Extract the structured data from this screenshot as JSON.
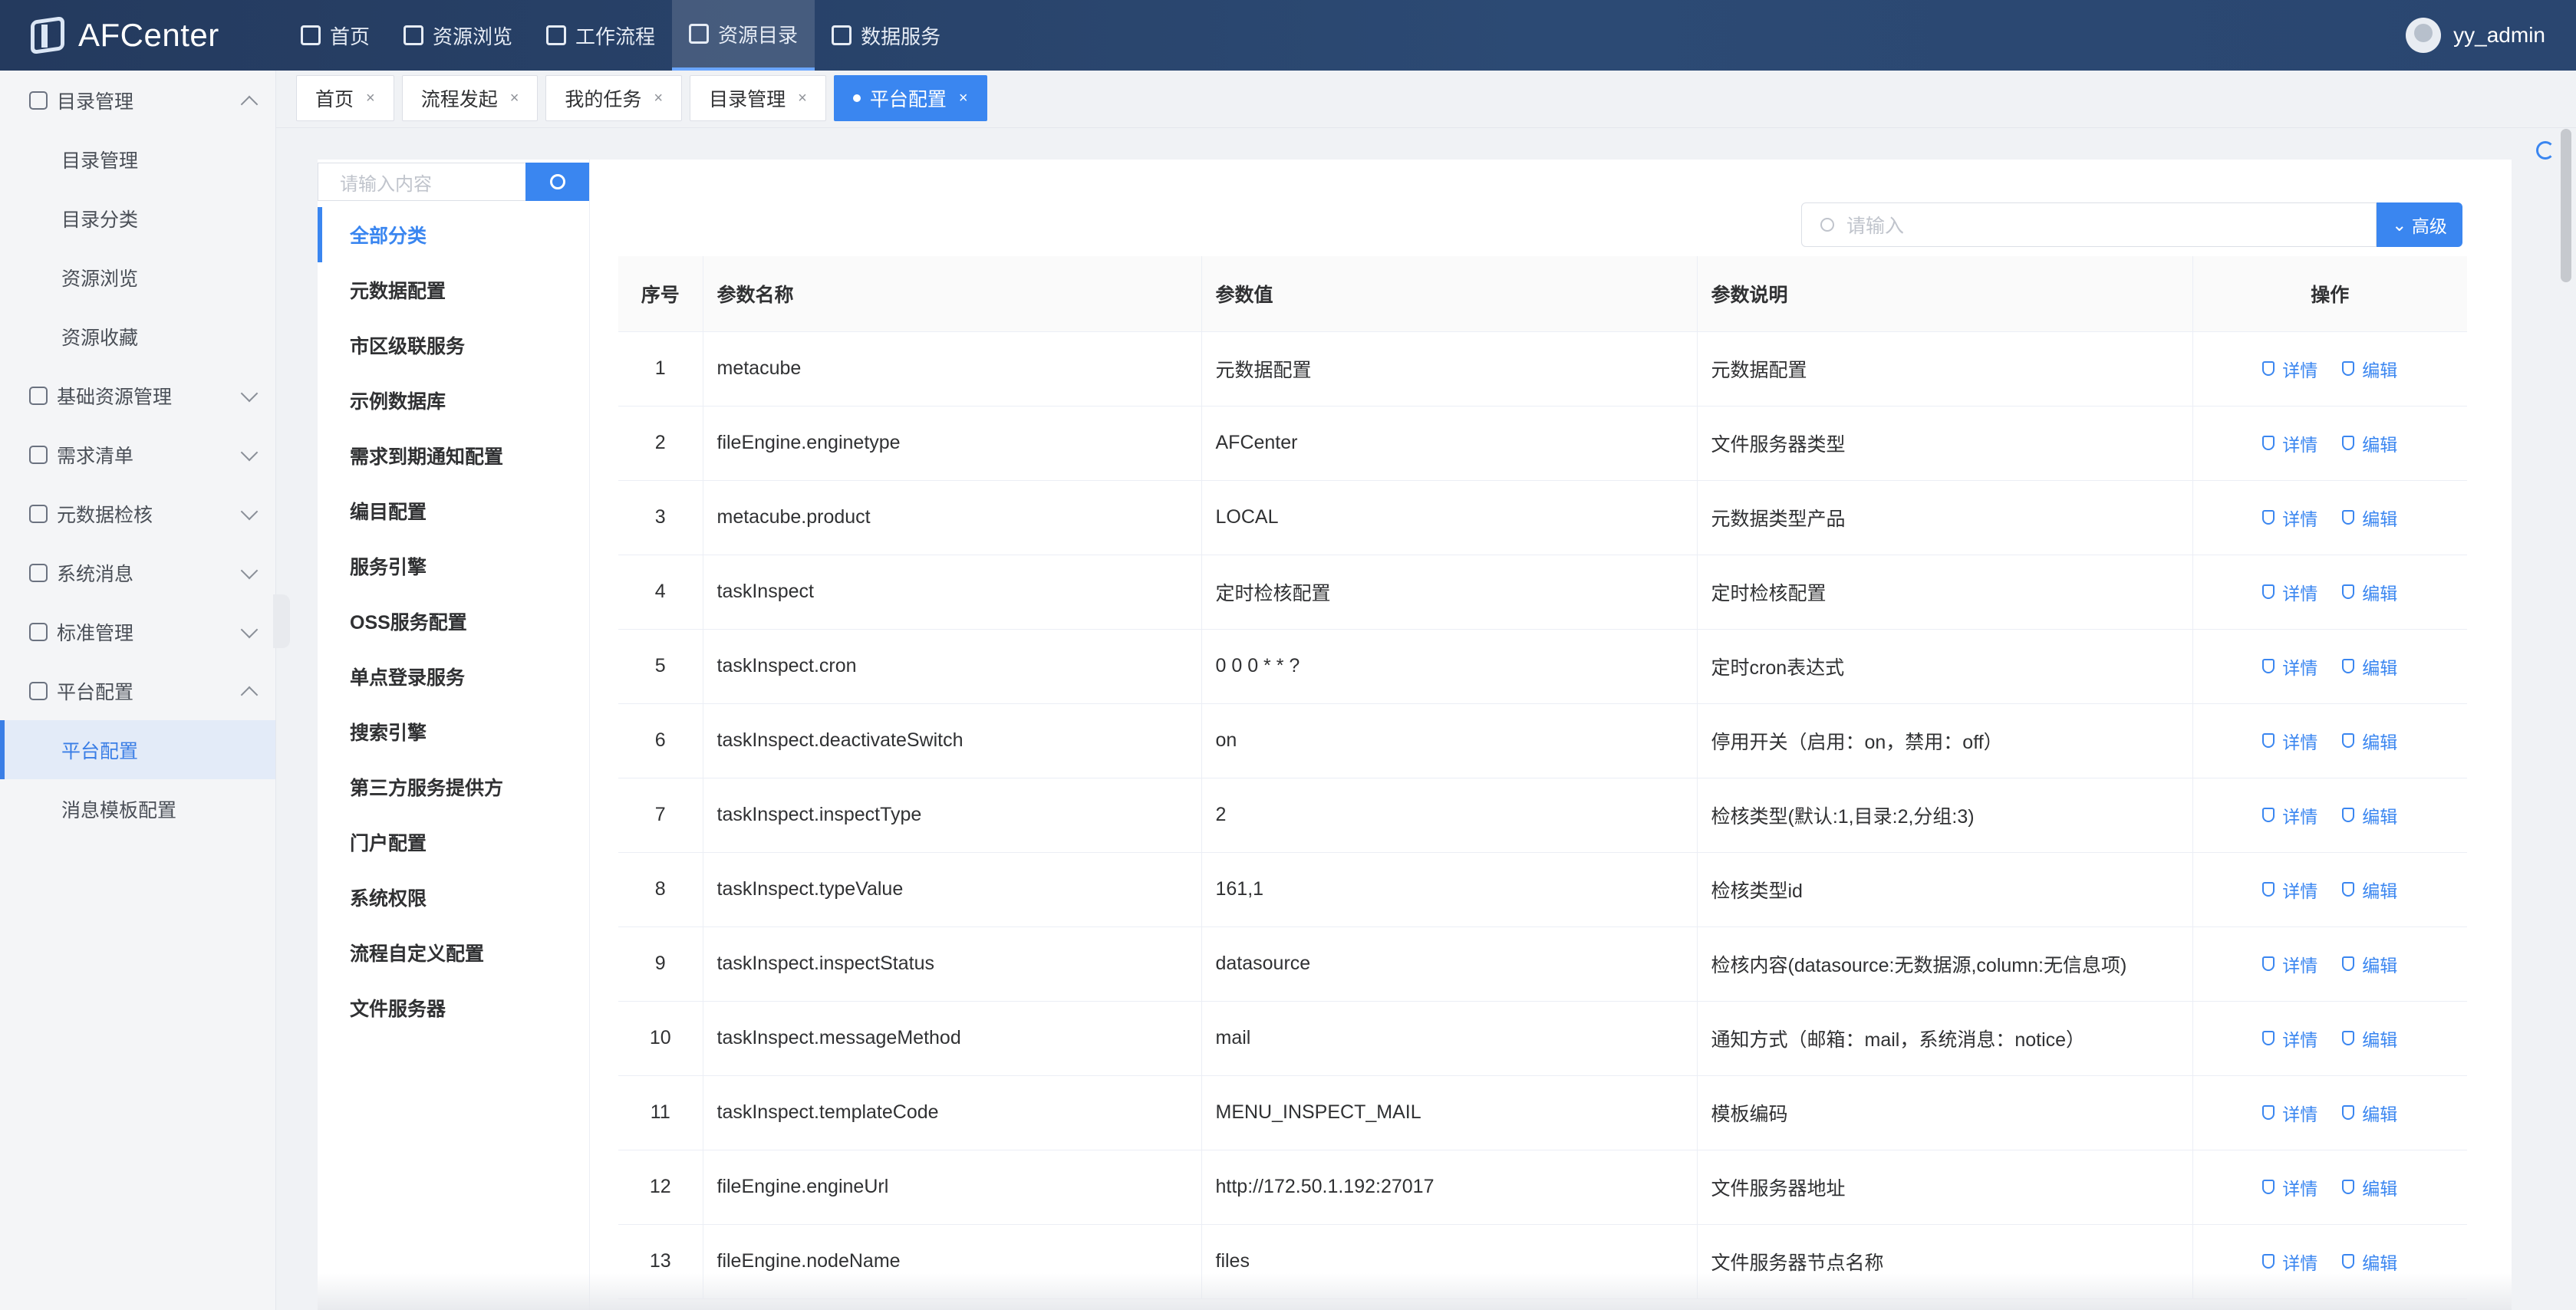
{
  "app": {
    "logo_text": "AFCenter"
  },
  "topnav": [
    {
      "label": "首页",
      "icon": "home-icon"
    },
    {
      "label": "资源浏览",
      "icon": "book-icon"
    },
    {
      "label": "工作流程",
      "icon": "flow-icon"
    },
    {
      "label": "资源目录",
      "icon": "folder-icon",
      "active": true
    },
    {
      "label": "数据服务",
      "icon": "service-icon"
    }
  ],
  "user": {
    "name": "yy_admin"
  },
  "sidebar": {
    "groups": [
      {
        "label": "目录管理",
        "open": true,
        "icon": "folder-icon",
        "items": [
          "目录管理",
          "目录分类",
          "资源浏览",
          "资源收藏"
        ]
      },
      {
        "label": "基础资源管理",
        "open": false,
        "icon": "layers-icon"
      },
      {
        "label": "需求清单",
        "open": false,
        "icon": "headset-icon"
      },
      {
        "label": "元数据检核",
        "open": false,
        "icon": "shield-icon"
      },
      {
        "label": "系统消息",
        "open": false,
        "icon": "chat-icon"
      },
      {
        "label": "标准管理",
        "open": false,
        "icon": "clipboard-icon"
      },
      {
        "label": "平台配置",
        "open": true,
        "icon": "gear-icon",
        "items": [
          "平台配置",
          "消息模板配置"
        ],
        "active_item": "平台配置"
      }
    ]
  },
  "tabs": [
    {
      "label": "首页",
      "close": "×"
    },
    {
      "label": "流程发起",
      "close": "×"
    },
    {
      "label": "我的任务",
      "close": "×"
    },
    {
      "label": "目录管理",
      "close": "×"
    },
    {
      "label": "平台配置",
      "close": "×",
      "active": true
    }
  ],
  "category_panel": {
    "search_placeholder": "请输入内容",
    "items": [
      "全部分类",
      "元数据配置",
      "市区级联服务",
      "示例数据库",
      "需求到期通知配置",
      "编目配置",
      "服务引擎",
      "OSS服务配置",
      "单点登录服务",
      "搜索引擎",
      "第三方服务提供方",
      "门户配置",
      "系统权限",
      "流程自定义配置",
      "文件服务器"
    ],
    "active": "全部分类"
  },
  "search": {
    "placeholder": "请输入",
    "advanced_label": "高级"
  },
  "table": {
    "headers": [
      "序号",
      "参数名称",
      "参数值",
      "参数说明",
      "操作"
    ],
    "detail_label": "详情",
    "edit_label": "编辑",
    "rows": [
      [
        "1",
        "metacube",
        "元数据配置",
        "元数据配置"
      ],
      [
        "2",
        "fileEngine.enginetype",
        "AFCenter",
        "文件服务器类型"
      ],
      [
        "3",
        "metacube.product",
        "LOCAL",
        "元数据类型产品"
      ],
      [
        "4",
        "taskInspect",
        "定时检核配置",
        "定时检核配置"
      ],
      [
        "5",
        "taskInspect.cron",
        "0 0 0 * * ?",
        "定时cron表达式"
      ],
      [
        "6",
        "taskInspect.deactivateSwitch",
        "on",
        "停用开关（启用：on，禁用：off）"
      ],
      [
        "7",
        "taskInspect.inspectType",
        "2",
        "检核类型(默认:1,目录:2,分组:3)"
      ],
      [
        "8",
        "taskInspect.typeValue",
        "161,1",
        "检核类型id"
      ],
      [
        "9",
        "taskInspect.inspectStatus",
        "datasource",
        "检核内容(datasource:无数据源,column:无信息项)"
      ],
      [
        "10",
        "taskInspect.messageMethod",
        "mail",
        "通知方式（邮箱：mail，系统消息：notice）"
      ],
      [
        "11",
        "taskInspect.templateCode",
        "MENU_INSPECT_MAIL",
        "模板编码"
      ],
      [
        "12",
        "fileEngine.engineUrl",
        "http://172.50.1.192:27017",
        "文件服务器地址"
      ],
      [
        "13",
        "fileEngine.nodeName",
        "files",
        "文件服务器节点名称"
      ]
    ]
  },
  "colors": {
    "topbar": "#2c4a74",
    "accent": "#3a86f0",
    "sidebar_bg": "#f4f5f7"
  }
}
